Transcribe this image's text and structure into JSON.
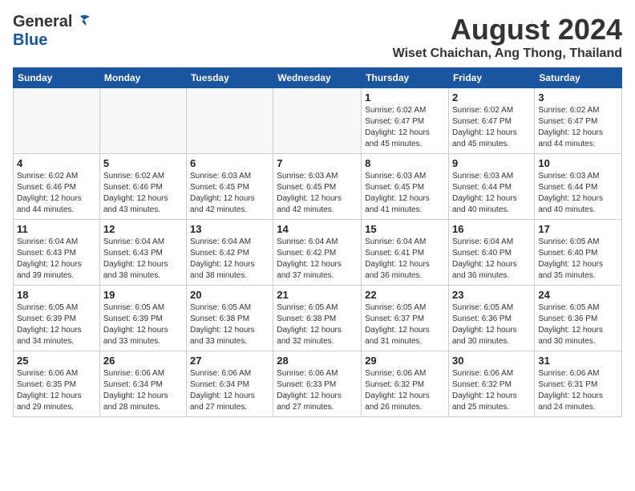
{
  "logo": {
    "general": "General",
    "blue": "Blue"
  },
  "title": "August 2024",
  "subtitle": "Wiset Chaichan, Ang Thong, Thailand",
  "days_of_week": [
    "Sunday",
    "Monday",
    "Tuesday",
    "Wednesday",
    "Thursday",
    "Friday",
    "Saturday"
  ],
  "weeks": [
    [
      {
        "day": "",
        "info": ""
      },
      {
        "day": "",
        "info": ""
      },
      {
        "day": "",
        "info": ""
      },
      {
        "day": "",
        "info": ""
      },
      {
        "day": "1",
        "info": "Sunrise: 6:02 AM\nSunset: 6:47 PM\nDaylight: 12 hours\nand 45 minutes."
      },
      {
        "day": "2",
        "info": "Sunrise: 6:02 AM\nSunset: 6:47 PM\nDaylight: 12 hours\nand 45 minutes."
      },
      {
        "day": "3",
        "info": "Sunrise: 6:02 AM\nSunset: 6:47 PM\nDaylight: 12 hours\nand 44 minutes."
      }
    ],
    [
      {
        "day": "4",
        "info": "Sunrise: 6:02 AM\nSunset: 6:46 PM\nDaylight: 12 hours\nand 44 minutes."
      },
      {
        "day": "5",
        "info": "Sunrise: 6:02 AM\nSunset: 6:46 PM\nDaylight: 12 hours\nand 43 minutes."
      },
      {
        "day": "6",
        "info": "Sunrise: 6:03 AM\nSunset: 6:45 PM\nDaylight: 12 hours\nand 42 minutes."
      },
      {
        "day": "7",
        "info": "Sunrise: 6:03 AM\nSunset: 6:45 PM\nDaylight: 12 hours\nand 42 minutes."
      },
      {
        "day": "8",
        "info": "Sunrise: 6:03 AM\nSunset: 6:45 PM\nDaylight: 12 hours\nand 41 minutes."
      },
      {
        "day": "9",
        "info": "Sunrise: 6:03 AM\nSunset: 6:44 PM\nDaylight: 12 hours\nand 40 minutes."
      },
      {
        "day": "10",
        "info": "Sunrise: 6:03 AM\nSunset: 6:44 PM\nDaylight: 12 hours\nand 40 minutes."
      }
    ],
    [
      {
        "day": "11",
        "info": "Sunrise: 6:04 AM\nSunset: 6:43 PM\nDaylight: 12 hours\nand 39 minutes."
      },
      {
        "day": "12",
        "info": "Sunrise: 6:04 AM\nSunset: 6:43 PM\nDaylight: 12 hours\nand 38 minutes."
      },
      {
        "day": "13",
        "info": "Sunrise: 6:04 AM\nSunset: 6:42 PM\nDaylight: 12 hours\nand 38 minutes."
      },
      {
        "day": "14",
        "info": "Sunrise: 6:04 AM\nSunset: 6:42 PM\nDaylight: 12 hours\nand 37 minutes."
      },
      {
        "day": "15",
        "info": "Sunrise: 6:04 AM\nSunset: 6:41 PM\nDaylight: 12 hours\nand 36 minutes."
      },
      {
        "day": "16",
        "info": "Sunrise: 6:04 AM\nSunset: 6:40 PM\nDaylight: 12 hours\nand 36 minutes."
      },
      {
        "day": "17",
        "info": "Sunrise: 6:05 AM\nSunset: 6:40 PM\nDaylight: 12 hours\nand 35 minutes."
      }
    ],
    [
      {
        "day": "18",
        "info": "Sunrise: 6:05 AM\nSunset: 6:39 PM\nDaylight: 12 hours\nand 34 minutes."
      },
      {
        "day": "19",
        "info": "Sunrise: 6:05 AM\nSunset: 6:39 PM\nDaylight: 12 hours\nand 33 minutes."
      },
      {
        "day": "20",
        "info": "Sunrise: 6:05 AM\nSunset: 6:38 PM\nDaylight: 12 hours\nand 33 minutes."
      },
      {
        "day": "21",
        "info": "Sunrise: 6:05 AM\nSunset: 6:38 PM\nDaylight: 12 hours\nand 32 minutes."
      },
      {
        "day": "22",
        "info": "Sunrise: 6:05 AM\nSunset: 6:37 PM\nDaylight: 12 hours\nand 31 minutes."
      },
      {
        "day": "23",
        "info": "Sunrise: 6:05 AM\nSunset: 6:36 PM\nDaylight: 12 hours\nand 30 minutes."
      },
      {
        "day": "24",
        "info": "Sunrise: 6:05 AM\nSunset: 6:36 PM\nDaylight: 12 hours\nand 30 minutes."
      }
    ],
    [
      {
        "day": "25",
        "info": "Sunrise: 6:06 AM\nSunset: 6:35 PM\nDaylight: 12 hours\nand 29 minutes."
      },
      {
        "day": "26",
        "info": "Sunrise: 6:06 AM\nSunset: 6:34 PM\nDaylight: 12 hours\nand 28 minutes."
      },
      {
        "day": "27",
        "info": "Sunrise: 6:06 AM\nSunset: 6:34 PM\nDaylight: 12 hours\nand 27 minutes."
      },
      {
        "day": "28",
        "info": "Sunrise: 6:06 AM\nSunset: 6:33 PM\nDaylight: 12 hours\nand 27 minutes."
      },
      {
        "day": "29",
        "info": "Sunrise: 6:06 AM\nSunset: 6:32 PM\nDaylight: 12 hours\nand 26 minutes."
      },
      {
        "day": "30",
        "info": "Sunrise: 6:06 AM\nSunset: 6:32 PM\nDaylight: 12 hours\nand 25 minutes."
      },
      {
        "day": "31",
        "info": "Sunrise: 6:06 AM\nSunset: 6:31 PM\nDaylight: 12 hours\nand 24 minutes."
      }
    ]
  ]
}
